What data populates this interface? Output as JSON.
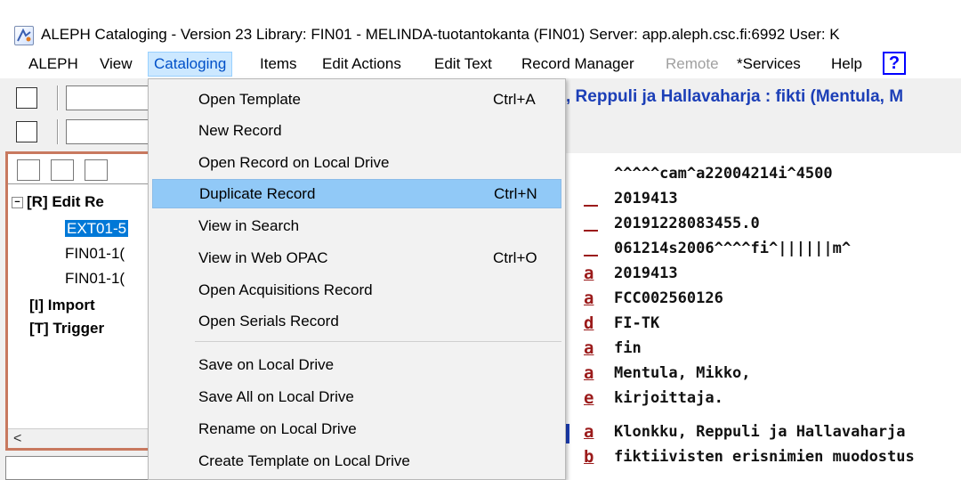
{
  "window": {
    "title": "ALEPH Cataloging - Version 23  Library:  FIN01 - MELINDA-tuotantokanta (FIN01)  Server:  app.aleph.csc.fi:6992  User:  K"
  },
  "menubar": {
    "items": [
      "ALEPH",
      "View",
      "Cataloging",
      "Items",
      "Edit Actions",
      "Edit Text",
      "Record Manager",
      "Remote",
      "*Services",
      "Help"
    ],
    "active": "Cataloging",
    "disabled": [
      "Remote"
    ],
    "help_icon": "?"
  },
  "header": {
    "record_title": ", Reppuli ja Hallavaharja : fikti (Mentula, M"
  },
  "tree": {
    "items": [
      {
        "label": "[R] Edit Re",
        "bold": true,
        "expander": "−"
      },
      {
        "label": "EXT01-5",
        "selected": true
      },
      {
        "label": "FIN01-1("
      },
      {
        "label": "FIN01-1("
      },
      {
        "label": "[I] Import",
        "bold": true
      },
      {
        "label": "[T] Trigger",
        "bold": true
      }
    ],
    "scroll_left": "<"
  },
  "dropdown": {
    "items": [
      {
        "label": "Open Template",
        "shortcut": "Ctrl+A"
      },
      {
        "label": "New Record",
        "shortcut": ""
      },
      {
        "label": "Open Record on Local Drive",
        "shortcut": ""
      },
      {
        "label": "Duplicate Record",
        "shortcut": "Ctrl+N",
        "highlighted": true
      },
      {
        "label": "View in Search",
        "shortcut": ""
      },
      {
        "label": "View in Web OPAC",
        "shortcut": "Ctrl+O"
      },
      {
        "label": "Open Acquisitions Record",
        "shortcut": ""
      },
      {
        "label": "Open Serials Record",
        "shortcut": ""
      },
      {
        "label": "Save on Local Drive",
        "shortcut": ""
      },
      {
        "label": "Save All on Local Drive",
        "shortcut": ""
      },
      {
        "label": "Rename on Local Drive",
        "shortcut": ""
      },
      {
        "label": "Create Template on Local Drive",
        "shortcut": ""
      }
    ]
  },
  "record": {
    "lines": [
      {
        "code": "",
        "text": "^^^^^cam^a22004214i^4500"
      },
      {
        "code": "",
        "text": "2019413"
      },
      {
        "code": "",
        "text": "20191228083455.0"
      },
      {
        "code": "",
        "text": "061214s2006^^^^fi^||||||m^"
      },
      {
        "code": "a",
        "text": "2019413"
      },
      {
        "code": "a",
        "text": "FCC002560126"
      },
      {
        "code": "d",
        "text": "FI-TK"
      },
      {
        "code": "a",
        "text": "fin"
      },
      {
        "code": "a",
        "text": "Mentula, Mikko,"
      },
      {
        "code": "e",
        "text": "kirjoittaja."
      },
      {
        "code": "a",
        "text": "Klonkku, Reppuli ja Hallavaharja"
      },
      {
        "code": "b",
        "text": "fiktiivisten erisnimien muodostus"
      }
    ]
  },
  "colors": {
    "selection": "#0078d7",
    "menu_highlight": "#91c9f7",
    "subfield_code": "#9b1b1b",
    "header_title": "#1c3fb7"
  }
}
